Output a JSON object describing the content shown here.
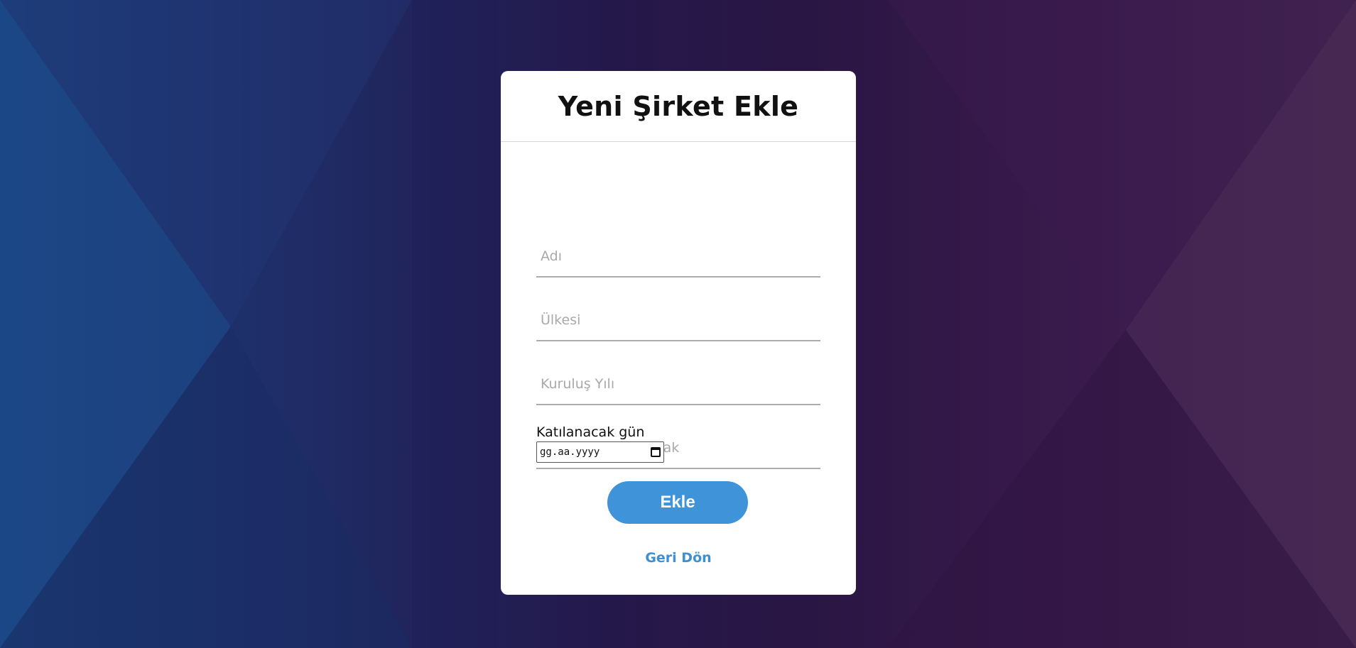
{
  "page": {
    "title": "Yeni Şirket Ekle"
  },
  "form": {
    "name_placeholder": "Adı",
    "country_placeholder": "Ülkesi",
    "founded_placeholder": "Kuruluş Yılı",
    "games_placeholder": "Kaç oyunla katılacak",
    "date_label": "Katılanacak gün",
    "date_placeholder": "gg.aa.yyyy",
    "date_icon": "calendar-icon",
    "submit_label": "Ekle",
    "back_label": "Geri Dön"
  },
  "colors": {
    "accent": "#3f93d8",
    "link": "#3f8fd4",
    "card_bg": "#ffffff"
  }
}
